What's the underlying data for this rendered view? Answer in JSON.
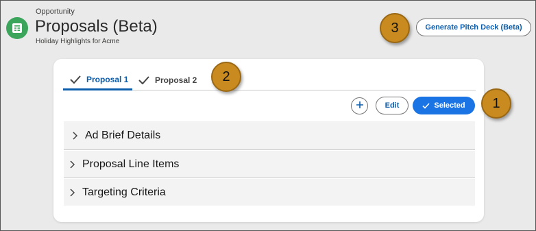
{
  "header": {
    "object_label": "Opportunity",
    "title": "Proposals (Beta)",
    "subtitle": "Holiday Highlights for Acme",
    "icon": "record-icon",
    "icon_color": "#3ba55c"
  },
  "actions": {
    "pitch_deck_label": "Generate Pitch Deck (Beta)"
  },
  "callouts": [
    "1",
    "2",
    "3"
  ],
  "tabs": [
    {
      "label": "Proposal 1",
      "active": true,
      "icon": "check-icon"
    },
    {
      "label": "Proposal 2",
      "active": false,
      "icon": "check-icon"
    }
  ],
  "toolbar": {
    "add_icon": "plus-icon",
    "edit_label": "Edit",
    "selected_label": "Selected"
  },
  "sections": [
    {
      "label": "Ad Brief Details",
      "icon": "chevron-right-icon"
    },
    {
      "label": "Proposal Line Items",
      "icon": "chevron-right-icon"
    },
    {
      "label": "Targeting Criteria",
      "icon": "chevron-right-icon"
    }
  ],
  "colors": {
    "brand_blue": "#0b5cab",
    "selected_bg": "#1b74e4",
    "callout": "#c98b1f"
  }
}
